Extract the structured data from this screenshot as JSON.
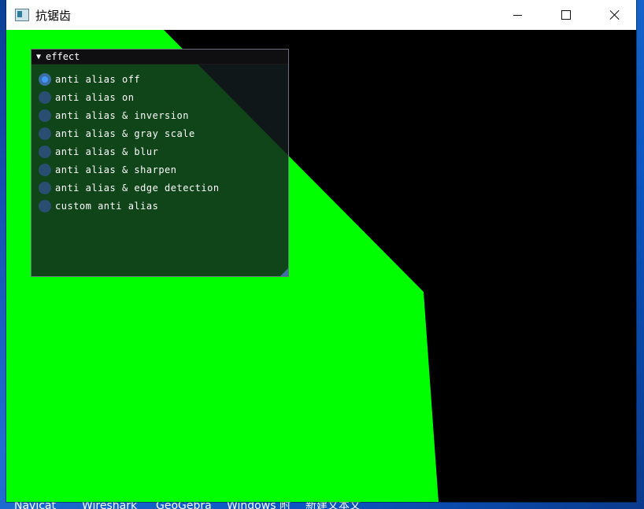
{
  "window": {
    "title": "抗锯齿",
    "controls": {
      "minimize": "minimize",
      "maximize": "maximize",
      "close": "close"
    }
  },
  "panel": {
    "header": "effect",
    "options": [
      {
        "label": "anti alias off",
        "checked": true
      },
      {
        "label": "anti alias on",
        "checked": false
      },
      {
        "label": "anti alias & inversion",
        "checked": false
      },
      {
        "label": "anti alias & gray scale",
        "checked": false
      },
      {
        "label": "anti alias & blur",
        "checked": false
      },
      {
        "label": "anti alias & sharpen",
        "checked": false
      },
      {
        "label": "anti alias & edge detection",
        "checked": false
      },
      {
        "label": "custom anti alias",
        "checked": false
      }
    ]
  },
  "scene": {
    "shape_color": "#00ff00",
    "background_color": "#000000"
  },
  "desktop": {
    "taskbar_labels": [
      "Navicat",
      "Wireshark",
      "GeoGebra",
      "Windows 附",
      "新建文本文"
    ]
  },
  "colors": {
    "accent": "#4296fa",
    "radio_bg": "#2a4e72"
  }
}
